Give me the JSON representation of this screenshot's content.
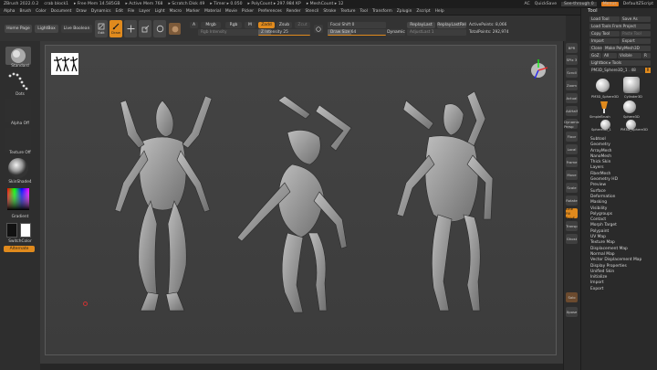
{
  "titlebar": {
    "items": [
      "ZBrush 2022.0.2",
      "crab block1",
      "▸ Free Mem 14.585GB",
      "▸ Active Mem 768",
      "▸ Scratch Disk 49",
      "▸ Timer ▸ 0.050",
      "▸ PolyCount ▸ 297.984 KP",
      "▸ MeshCount ▸ 12"
    ],
    "ac": "AC",
    "quicksave": "QuickSave",
    "seethrough": "See-through  0",
    "menus_btn": "Menus",
    "script": "DefaultZScript"
  },
  "menubar": [
    "Alpha",
    "Brush",
    "Color",
    "Document",
    "Draw",
    "Dynamics",
    "Edit",
    "File",
    "Layer",
    "Light",
    "Macro",
    "Marker",
    "Material",
    "Movie",
    "Picker",
    "Preferences",
    "Render",
    "Stencil",
    "Stroke",
    "Texture",
    "Tool",
    "Transform",
    "Zplugin",
    "Zscript",
    "Help"
  ],
  "toolbar": {
    "home": "Home Page",
    "lightbox": "LightBox",
    "live_boolean": "Live Boolean",
    "edit": "Edit",
    "draw": "Draw",
    "a": "A",
    "mrgb": "Mrgb",
    "rgb": "Rgb",
    "m": "M",
    "zadd": "Zadd",
    "zsub": "Zsub",
    "zcut": "Zcut",
    "rgb_intensity": "Rgb Intensity",
    "z_intensity": "Z Intensity 25",
    "focal_shift": "Focal Shift 0",
    "draw_size": "Draw Size 64",
    "dynamic": "Dynamic",
    "replay_last": "ReplayLast",
    "replay_last_rel": "ReplayLastRel",
    "adjust_last": "AdjustLast 1",
    "active_points": "ActivePoints: 8,066",
    "total_points": "TotalPoints: 292,974"
  },
  "leftshelf": {
    "standard": "Standard",
    "dots": "Dots",
    "alpha_off": "Alpha Off",
    "texture_off": "Texture Off",
    "material": "SkinShade4",
    "gradient": "Gradient",
    "switch_color": "SwitchColor",
    "alternate": "Alternate"
  },
  "rightshelf": [
    "BPR",
    "SPix 3",
    "Scroll",
    "Zoom",
    "Actual",
    "AAHalf",
    "Dynamic Persp",
    "Floor",
    "Local",
    "Frame",
    "Move",
    "Scale",
    "Rotate",
    "Line Fill PolyF",
    "Transp",
    "Ghost",
    "Solo",
    "Xpose"
  ],
  "tray": {
    "title": "Tool",
    "buttons": [
      [
        "Load Tool",
        "Save As"
      ],
      [
        "Load Tools From Project"
      ],
      [
        "Copy Tool",
        "Paste Tool"
      ],
      [
        "Import",
        "Export"
      ],
      [
        "Clone",
        "Make PolyMesh3D"
      ],
      [
        "GoZ",
        "All",
        "Visible",
        "R"
      ],
      [
        "Lightbox ▸ Tools"
      ]
    ],
    "current": "PM3D_Sphere3D_1 . 48",
    "thumbs": [
      "PM3D_Sphere3D",
      "Cylinder3D",
      "SimpleBrush",
      "Sphere3D",
      "Sphere3D_1",
      "PM3D_Sphere3D"
    ],
    "list": [
      "Subtool",
      "Geometry",
      "ArrayMesh",
      "NanoMesh",
      "Thick Skin",
      "Layers",
      "FiberMesh",
      "Geometry HD",
      "Preview",
      "Surface",
      "Deformation",
      "Masking",
      "Visibility",
      "Polygroups",
      "Contact",
      "Morph Target",
      "Polypaint",
      "UV Map",
      "Texture Map",
      "Displacement Map",
      "Normal Map",
      "Vector Displacement Map",
      "Display Properties",
      "Unified Skin",
      "Initialize",
      "Import",
      "Export"
    ]
  },
  "colors": {
    "accent": "#e08a1d",
    "background": "#2b2b2b",
    "canvas": "#404040"
  }
}
